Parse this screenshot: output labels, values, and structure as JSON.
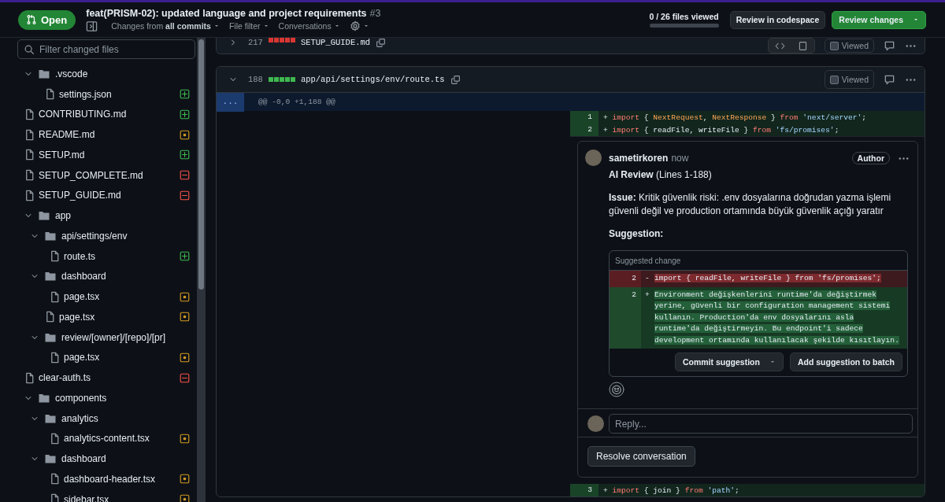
{
  "header": {
    "state": {
      "label": "Open"
    },
    "title": "feat(PRISM-02): updated language and project requirements",
    "number": "#3",
    "toolbar": [
      {
        "kind": "sidebar-toggle"
      },
      {
        "kind": "menu",
        "label": "Changes from **all commits**"
      },
      {
        "kind": "menu",
        "label": "File filter"
      },
      {
        "kind": "menu",
        "label": "Conversations"
      },
      {
        "kind": "settings"
      }
    ],
    "progress": {
      "label": "0 / 26 files viewed",
      "level": 0
    },
    "buttons": [
      {
        "kind": "secondary",
        "label": "Review in codespace"
      },
      {
        "kind": "primary",
        "label": "Review changes"
      }
    ]
  },
  "sidebar": {
    "filter": {
      "placeholder": "Filter changed files"
    },
    "tree": [
      {
        "kind": "folder",
        "name": ".vscode",
        "expanded": true,
        "children": [
          {
            "kind": "file",
            "name": "settings.json",
            "badge": {
              "kind": "added"
            }
          }
        ]
      },
      {
        "kind": "file",
        "name": "CONTRIBUTING.md",
        "badge": {
          "kind": "added"
        }
      },
      {
        "kind": "file",
        "name": "README.md",
        "badge": {
          "kind": "modified"
        }
      },
      {
        "kind": "file",
        "name": "SETUP.md",
        "badge": {
          "kind": "added"
        }
      },
      {
        "kind": "file",
        "name": "SETUP_COMPLETE.md",
        "badge": {
          "kind": "deleted"
        }
      },
      {
        "kind": "file",
        "name": "SETUP_GUIDE.md",
        "badge": {
          "kind": "deleted"
        }
      },
      {
        "kind": "folder",
        "name": "app",
        "expanded": true,
        "children": [
          {
            "kind": "folder",
            "name": "api/settings/env",
            "expanded": true,
            "children": [
              {
                "kind": "file",
                "name": "route.ts",
                "badge": {
                  "kind": "added"
                }
              }
            ]
          },
          {
            "kind": "folder",
            "name": "dashboard",
            "expanded": true,
            "children": [
              {
                "kind": "file",
                "name": "page.tsx",
                "badge": {
                  "kind": "modified"
                }
              }
            ]
          },
          {
            "kind": "file",
            "name": "page.tsx",
            "badge": {
              "kind": "modified"
            }
          },
          {
            "kind": "folder",
            "name": "review/[owner]/[repo]/[pr]",
            "expanded": true,
            "children": [
              {
                "kind": "file",
                "name": "page.tsx",
                "badge": {
                  "kind": "modified"
                }
              }
            ]
          }
        ]
      },
      {
        "kind": "file",
        "name": "clear-auth.ts",
        "badge": {
          "kind": "deleted"
        }
      },
      {
        "kind": "folder",
        "name": "components",
        "expanded": true,
        "children": [
          {
            "kind": "folder",
            "name": "analytics",
            "expanded": true,
            "children": [
              {
                "kind": "file",
                "name": "analytics-content.tsx",
                "badge": {
                  "kind": "modified"
                }
              }
            ]
          },
          {
            "kind": "folder",
            "name": "dashboard",
            "expanded": true,
            "children": [
              {
                "kind": "file",
                "name": "dashboard-header.tsx",
                "badge": {
                  "kind": "modified"
                }
              },
              {
                "kind": "file",
                "name": "sidebar.tsx",
                "badge": {
                  "kind": "modified"
                }
              }
            ]
          }
        ]
      }
    ]
  },
  "files": [
    {
      "count": "217",
      "blocks": [
        {
          "kind": "deleted"
        },
        {
          "kind": "deleted"
        },
        {
          "kind": "deleted"
        },
        {
          "kind": "deleted"
        },
        {
          "kind": "deleted"
        }
      ],
      "path": "SETUP_GUIDE.md",
      "collapsed": true,
      "view_toggle": true,
      "viewed": false,
      "viewed_label": "Viewed"
    },
    {
      "count": "188",
      "blocks": [
        {
          "kind": "added"
        },
        {
          "kind": "added"
        },
        {
          "kind": "added"
        },
        {
          "kind": "added"
        },
        {
          "kind": "added"
        }
      ],
      "path": "app/api/settings/env/route.ts",
      "collapsed": false,
      "view_toggle": false,
      "viewed": false,
      "viewed_label": "Viewed",
      "hunk": {
        "expander": "...",
        "header": "@@ -0,0 +1,188 @@"
      },
      "lines": [
        {
          "number": "1",
          "sign": "+",
          "tokens": [
            {
              "kind": "keyword",
              "text": "import"
            },
            {
              "kind": "plain",
              "text": " { "
            },
            {
              "kind": "name",
              "text": "NextRequest"
            },
            {
              "kind": "plain",
              "text": ", "
            },
            {
              "kind": "name",
              "text": "NextResponse"
            },
            {
              "kind": "plain",
              "text": " } "
            },
            {
              "kind": "keyword",
              "text": "from"
            },
            {
              "kind": "string",
              "text": "'next/server'"
            },
            {
              "kind": "plain",
              "text": ";"
            }
          ]
        },
        {
          "number": "2",
          "sign": "+",
          "tokens": [
            {
              "kind": "keyword",
              "text": "import"
            },
            {
              "kind": "plain",
              "text": " { readFile, writeFile } "
            },
            {
              "kind": "keyword",
              "text": "from"
            },
            {
              "kind": "string",
              "text": "'fs/promises'"
            },
            {
              "kind": "plain",
              "text": ";"
            }
          ]
        }
      ],
      "thread": {
        "author": "sametirkoren",
        "time": "now",
        "badge": "Author",
        "body": [
          "**AI Review** (Lines 1-188)",
          "**Issue:** Kritik güvenlik riski: .env dosyalarına doğrudan yazma işlemi güvenli değil ve production ortamında büyük güvenlik açığı yaratır"
        ],
        "suggestion_label": "Suggestion:",
        "suggestion": {
          "title": "Suggested change",
          "rows": [
            {
              "kind": "deleted",
              "number": "2",
              "sign": "-",
              "code": "import { readFile, writeFile } from 'fs/promises';"
            },
            {
              "kind": "added",
              "number": "2",
              "sign": "+",
              "code": "Environment değişkenlerini runtime'da değiştirmek yerine, güvenli bir configuration management sistemi kullanın. Production'da env dosyalarını asla runtime'da değiştirmeyin. Bu endpoint'i sadece development ortamında kullanılacak şekilde kısıtlayın."
            }
          ],
          "buttons": [
            {
              "label": "Commit suggestion",
              "menu": true
            },
            {
              "label": "Add suggestion to batch",
              "menu": false
            }
          ]
        },
        "reply": {
          "placeholder": "Reply..."
        },
        "resolve": "Resolve conversation"
      },
      "lines_after": [
        {
          "number": "3",
          "sign": "+",
          "tokens": [
            {
              "kind": "keyword",
              "text": "import"
            },
            {
              "kind": "plain",
              "text": " { join } "
            },
            {
              "kind": "keyword",
              "text": "from"
            },
            {
              "kind": "string",
              "text": "'path'"
            },
            {
              "kind": "plain",
              "text": ";"
            }
          ]
        }
      ]
    }
  ]
}
